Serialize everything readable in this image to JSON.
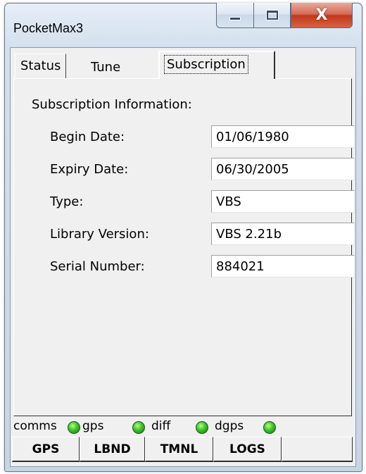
{
  "window": {
    "title": "PocketMax3",
    "close_glyph": "X"
  },
  "tabs": [
    {
      "label": "Status"
    },
    {
      "label": "Tune"
    },
    {
      "label": "Subscription"
    }
  ],
  "subscription": {
    "heading": "Subscription Information:",
    "fields": [
      {
        "label": "Begin Date:",
        "value": "01/06/1980"
      },
      {
        "label": "Expiry Date:",
        "value": "06/30/2005"
      },
      {
        "label": "Type:",
        "value": "VBS"
      },
      {
        "label": "Library Version:",
        "value": "VBS 2.21b"
      },
      {
        "label": "Serial Number:",
        "value": "884021"
      }
    ]
  },
  "indicators": [
    {
      "label": "comms",
      "color": "#3cc22e"
    },
    {
      "label": "gps",
      "color": "#3cc22e"
    },
    {
      "label": "diff",
      "color": "#3cc22e"
    },
    {
      "label": "dgps",
      "color": "#3cc22e"
    }
  ],
  "bottom_tabs": [
    {
      "label": "GPS"
    },
    {
      "label": "LBND"
    },
    {
      "label": "TMNL"
    },
    {
      "label": "LOGS"
    },
    {
      "label": ""
    }
  ]
}
